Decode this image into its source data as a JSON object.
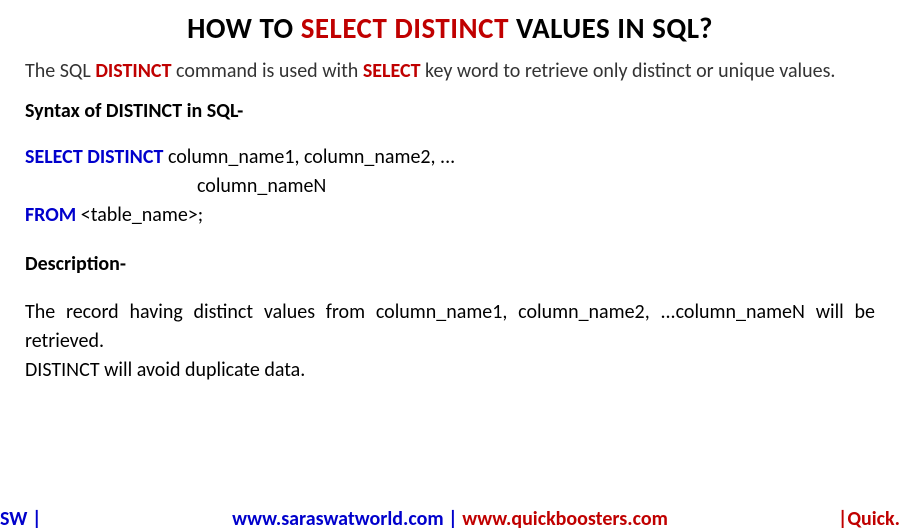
{
  "title": {
    "p1": "HOW TO ",
    "p2": "SELECT DISTINCT",
    "p3": " VALUES IN SQL?"
  },
  "intro": {
    "p1": "The SQL ",
    "p2": "DISTINCT",
    "p3": " command is used with ",
    "p4": "SELECT",
    "p5": " key word to retrieve only distinct or unique values."
  },
  "syntax_head": "Syntax of DISTINCT in SQL-",
  "syntax": {
    "kw1": "SELECT DISTINCT",
    "line1_rest": " column_name1, column_name2, ...",
    "line2": "column_nameN",
    "kw2": "FROM",
    "line3_rest": " <table_name>;"
  },
  "desc_head": "Description-",
  "desc_body1": "The record having distinct values from column_name1, column_name2, ...column_nameN will be retrieved.",
  "desc_body2": "DISTINCT will avoid duplicate data.",
  "footer": {
    "left": "SW |",
    "center_blue": "www.saraswatworld.com | ",
    "center_red": "www.quickboosters.com",
    "right": "|Quick."
  },
  "colors": {
    "red": "#c00000",
    "blue": "#0000cc",
    "black": "#000000"
  }
}
